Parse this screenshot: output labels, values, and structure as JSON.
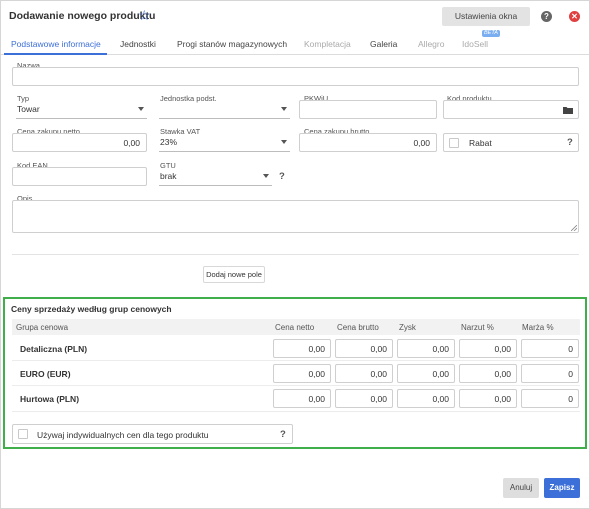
{
  "dialog": {
    "title": "Dodawanie nowego produktu",
    "window_settings_label": "Ustawienia okna"
  },
  "tabs": [
    {
      "label": "Podstawowe informacje",
      "state": "active"
    },
    {
      "label": "Jednostki",
      "state": "normal"
    },
    {
      "label": "Progi stanów magazynowych",
      "state": "normal"
    },
    {
      "label": "Kompletacja",
      "state": "disabled"
    },
    {
      "label": "Galeria",
      "state": "normal"
    },
    {
      "label": "Allegro",
      "state": "disabled"
    },
    {
      "label": "IdoSell",
      "state": "disabled",
      "badge": "BETA"
    }
  ],
  "form": {
    "name_label": "Nazwa",
    "name_value": "",
    "type_label": "Typ",
    "type_value": "Towar",
    "unit_label": "Jednostka podst.",
    "unit_value": "",
    "pkwiu_label": "PKWiU",
    "pkwiu_value": "",
    "product_code_label": "Kod produktu",
    "product_code_value": "",
    "purchase_net_label": "Cena zakupu netto",
    "purchase_net_value": "0,00",
    "vat_label": "Stawka VAT",
    "vat_value": "23%",
    "purchase_gross_label": "Cena zakupu brutto",
    "purchase_gross_value": "0,00",
    "discount_label": "Rabat",
    "ean_label": "Kod EAN",
    "ean_value": "",
    "gtu_label": "GTU",
    "gtu_value": "brak",
    "description_label": "Opis",
    "description_value": "",
    "add_field_label": "Dodaj nowe pole"
  },
  "prices": {
    "title": "Ceny sprzedaży według grup cenowych",
    "columns": [
      "Grupa cenowa",
      "Cena netto",
      "Cena brutto",
      "Zysk",
      "Narzut %",
      "Marża %"
    ],
    "rows": [
      {
        "name": "Detaliczna (PLN)",
        "values": [
          "0,00",
          "0,00",
          "0,00",
          "0,00",
          "0"
        ]
      },
      {
        "name": "EURO (EUR)",
        "values": [
          "0,00",
          "0,00",
          "0,00",
          "0,00",
          "0"
        ]
      },
      {
        "name": "Hurtowa (PLN)",
        "values": [
          "0,00",
          "0,00",
          "0,00",
          "0,00",
          "0"
        ]
      }
    ],
    "individual_prices_label": "Używaj indywidualnych cen dla tego produktu"
  },
  "footer": {
    "cancel_label": "Anuluj",
    "save_label": "Zapisz"
  },
  "colors": {
    "accent": "#3d6fd9",
    "highlight_border": "#3fae4b",
    "close": "#e04040"
  },
  "icons": [
    "star-icon",
    "help-icon",
    "close-icon",
    "folder-icon",
    "chevron-down-icon",
    "question-icon",
    "resize-handle-icon"
  ]
}
